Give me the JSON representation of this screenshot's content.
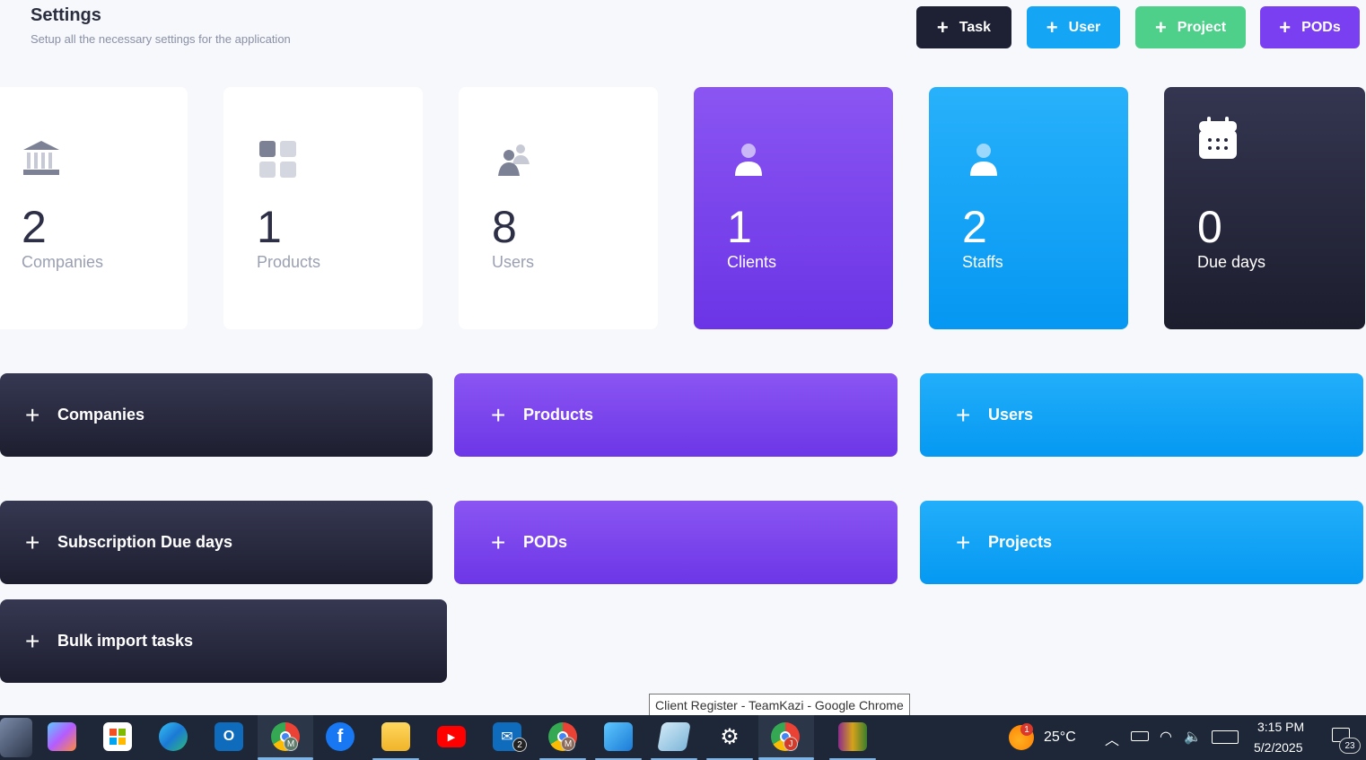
{
  "header": {
    "title": "Settings",
    "subtitle": "Setup all the necessary settings for the application"
  },
  "top_buttons": {
    "task": "Task",
    "user": "User",
    "project": "Project",
    "pods": "PODs"
  },
  "stats": [
    {
      "value": "2",
      "label": "Companies",
      "icon": "bank-icon"
    },
    {
      "value": "1",
      "label": "Products",
      "icon": "grid-icon"
    },
    {
      "value": "8",
      "label": "Users",
      "icon": "users-icon"
    },
    {
      "value": "1",
      "label": "Clients",
      "icon": "user-icon"
    },
    {
      "value": "2",
      "label": "Staffs",
      "icon": "user-icon"
    },
    {
      "value": "0",
      "label": "Due days",
      "icon": "calendar-icon"
    }
  ],
  "actions": {
    "companies": "Companies",
    "products": "Products",
    "users": "Users",
    "subscription": "Subscription Due days",
    "pods": "PODs",
    "projects": "Projects",
    "bulk": "Bulk import tasks"
  },
  "tooltip": "Client Register - TeamKazi - Google Chrome",
  "taskbar": {
    "weather": "25°C",
    "weather_badge": "1",
    "time": "3:15 PM",
    "date": "5/2/2025",
    "notifications": "23",
    "mail_badge": "2",
    "chrome_m_badge": "M",
    "chrome_j_badge": "J"
  },
  "colors": {
    "dark": "#1e2033",
    "blue": "#14a6f5",
    "green": "#4ecf8a",
    "purple": "#7a3ff0"
  }
}
